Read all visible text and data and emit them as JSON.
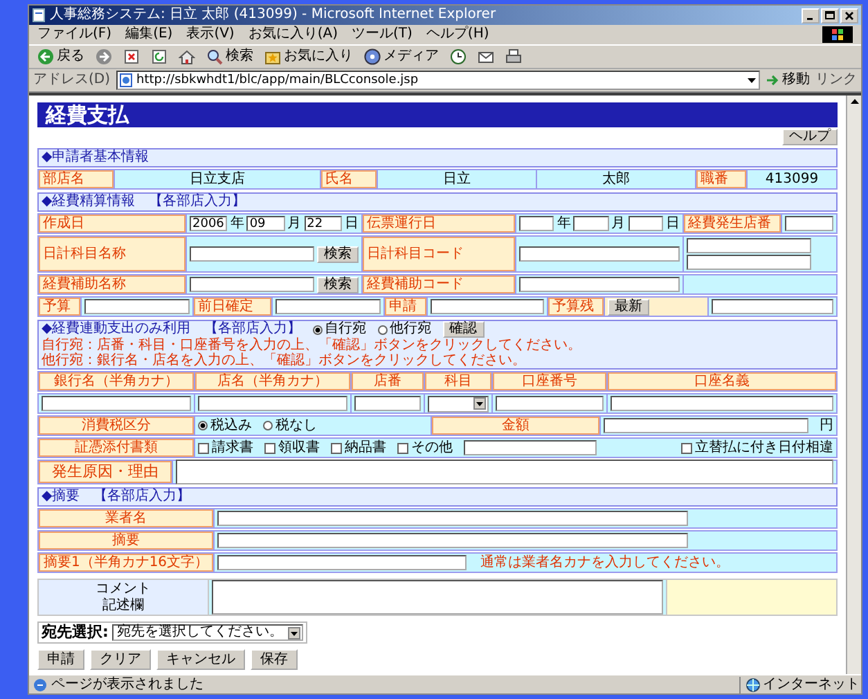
{
  "window": {
    "title": "人事総務システム: 日立 太郎 (413099) - Microsoft Internet Explorer"
  },
  "menu": [
    "ファイル(F)",
    "編集(E)",
    "表示(V)",
    "お気に入り(A)",
    "ツール(T)",
    "ヘルプ(H)"
  ],
  "toolbar": [
    {
      "kind": "back",
      "label": "戻る"
    },
    {
      "kind": "forward"
    },
    {
      "kind": "stop"
    },
    {
      "kind": "refresh"
    },
    {
      "kind": "home"
    },
    {
      "kind": "search",
      "label": "検索"
    },
    {
      "kind": "favorites",
      "label": "お気に入り"
    },
    {
      "kind": "media",
      "label": "メディア"
    },
    {
      "kind": "history"
    },
    {
      "kind": "mail"
    },
    {
      "kind": "print"
    }
  ],
  "address": {
    "label": "アドレス(D)",
    "url": "http://sbkwhdt1/blc/app/main/BLCconsole.jsp",
    "go": "移動",
    "links": "リンク"
  },
  "page": {
    "heading": "経費支払",
    "help": "ヘルプ",
    "blocks": [
      {
        "kind": "section",
        "title": "◆申請者基本情報"
      },
      {
        "kind": "row",
        "cells": [
          {
            "kind": "label",
            "text": "部店名"
          },
          {
            "kind": "value",
            "text": "日立支店"
          },
          {
            "kind": "label",
            "text": "氏名"
          },
          {
            "kind": "value",
            "text": "日立"
          },
          {
            "kind": "value",
            "text": "太郎"
          },
          {
            "kind": "label",
            "text": "職番"
          },
          {
            "kind": "value",
            "text": "413099"
          }
        ]
      },
      {
        "kind": "section",
        "title": "◆経費精算情報　【各部店入力】"
      },
      {
        "kind": "row",
        "cells": [
          {
            "kind": "label",
            "text": "作成日"
          },
          {
            "kind": "field",
            "items": [
              {
                "kind": "input",
                "value": "2006"
              },
              {
                "kind": "text",
                "text": "年"
              },
              {
                "kind": "input",
                "value": "09"
              },
              {
                "kind": "text",
                "text": "月"
              },
              {
                "kind": "input",
                "value": "22"
              },
              {
                "kind": "text",
                "text": "日"
              }
            ]
          },
          {
            "kind": "label",
            "text": "伝票運行日"
          },
          {
            "kind": "field",
            "items": [
              {
                "kind": "input"
              },
              {
                "kind": "text",
                "text": "年"
              },
              {
                "kind": "input"
              },
              {
                "kind": "text",
                "text": "月"
              },
              {
                "kind": "input"
              },
              {
                "kind": "text",
                "text": "日"
              }
            ]
          },
          {
            "kind": "label",
            "text": "経費発生店番"
          },
          {
            "kind": "field",
            "items": [
              {
                "kind": "input"
              }
            ]
          }
        ]
      },
      {
        "kind": "row",
        "cells": [
          {
            "kind": "label",
            "text": "日計科目名称"
          },
          {
            "kind": "field",
            "items": [
              {
                "kind": "input"
              },
              {
                "kind": "button",
                "label": "検索"
              }
            ]
          },
          {
            "kind": "label",
            "text": "日計科目コード"
          },
          {
            "kind": "field",
            "items": [
              {
                "kind": "input"
              }
            ]
          },
          {
            "kind": "stack",
            "items": [
              {
                "kind": "input"
              },
              {
                "kind": "input"
              }
            ]
          }
        ]
      },
      {
        "kind": "row",
        "cells": [
          {
            "kind": "label",
            "text": "経費補助名称"
          },
          {
            "kind": "field",
            "items": [
              {
                "kind": "input"
              },
              {
                "kind": "button",
                "label": "検索"
              }
            ]
          },
          {
            "kind": "label",
            "text": "経費補助コード"
          },
          {
            "kind": "field",
            "items": [
              {
                "kind": "input"
              }
            ]
          },
          {
            "kind": "blank"
          }
        ]
      },
      {
        "kind": "row",
        "cells": [
          {
            "kind": "label",
            "text": "予算"
          },
          {
            "kind": "field",
            "items": [
              {
                "kind": "input"
              }
            ]
          },
          {
            "kind": "label",
            "text": "前日確定"
          },
          {
            "kind": "field",
            "items": [
              {
                "kind": "input"
              }
            ]
          },
          {
            "kind": "label",
            "text": "申請"
          },
          {
            "kind": "field",
            "items": [
              {
                "kind": "input"
              }
            ]
          },
          {
            "kind": "label",
            "text": "予算残"
          },
          {
            "kind": "field",
            "items": [
              {
                "kind": "button",
                "label": "最新"
              }
            ]
          },
          {
            "kind": "field",
            "items": [
              {
                "kind": "input"
              }
            ]
          }
        ]
      },
      {
        "kind": "section",
        "title": "◆経費連動支出のみ利用　【各部店入力】",
        "controls": [
          {
            "kind": "radio",
            "label": "自行宛",
            "selected": true
          },
          {
            "kind": "radio",
            "label": "他行宛",
            "selected": false
          },
          {
            "kind": "button",
            "label": "確認"
          }
        ],
        "notes": [
          "自行宛：店番・科目・口座番号を入力の上、「確認」ボタンをクリックしてください。",
          "他行宛：銀行名・店名を入力の上、「確認」ボタンをクリックしてください。"
        ]
      },
      {
        "kind": "row",
        "cells": [
          {
            "kind": "header",
            "text": "銀行名（半角カナ）"
          },
          {
            "kind": "header",
            "text": "店名（半角カナ）"
          },
          {
            "kind": "header",
            "text": "店番"
          },
          {
            "kind": "header",
            "text": "科目"
          },
          {
            "kind": "header",
            "text": "口座番号"
          },
          {
            "kind": "header",
            "text": "口座名義"
          }
        ]
      },
      {
        "kind": "row",
        "cells": [
          {
            "kind": "field",
            "items": [
              {
                "kind": "input"
              }
            ]
          },
          {
            "kind": "field",
            "items": [
              {
                "kind": "input"
              }
            ]
          },
          {
            "kind": "field",
            "items": [
              {
                "kind": "input"
              }
            ]
          },
          {
            "kind": "field",
            "items": [
              {
                "kind": "select"
              }
            ]
          },
          {
            "kind": "field",
            "items": [
              {
                "kind": "input"
              }
            ]
          },
          {
            "kind": "field",
            "items": [
              {
                "kind": "input"
              }
            ]
          }
        ]
      },
      {
        "kind": "row",
        "cells": [
          {
            "kind": "label",
            "text": "消費税区分"
          },
          {
            "kind": "field",
            "items": [
              {
                "kind": "radio",
                "label": "税込み",
                "selected": true
              },
              {
                "kind": "radio",
                "label": "税なし",
                "selected": false
              }
            ]
          },
          {
            "kind": "label",
            "text": "金額"
          },
          {
            "kind": "field",
            "items": [
              {
                "kind": "input"
              },
              {
                "kind": "text",
                "text": "円"
              }
            ]
          }
        ]
      },
      {
        "kind": "row",
        "cells": [
          {
            "kind": "label",
            "text": "証憑添付書類"
          },
          {
            "kind": "field",
            "items": [
              {
                "kind": "checkbox",
                "label": "請求書",
                "checked": false
              },
              {
                "kind": "checkbox",
                "label": "領収書",
                "checked": false
              },
              {
                "kind": "checkbox",
                "label": "納品書",
                "checked": false
              },
              {
                "kind": "checkbox",
                "label": "その他",
                "checked": false
              },
              {
                "kind": "input"
              },
              {
                "kind": "checkbox",
                "label": "立替払に付き日付相違",
                "checked": false
              }
            ]
          }
        ]
      },
      {
        "kind": "row",
        "cells": [
          {
            "kind": "label",
            "text": "発生原因・理由"
          },
          {
            "kind": "field",
            "items": [
              {
                "kind": "textarea"
              }
            ]
          }
        ]
      },
      {
        "kind": "section",
        "title": "◆摘要　【各部店入力】"
      },
      {
        "kind": "row",
        "cells": [
          {
            "kind": "label",
            "text": "業者名"
          },
          {
            "kind": "field",
            "items": [
              {
                "kind": "input"
              }
            ]
          }
        ]
      },
      {
        "kind": "row",
        "cells": [
          {
            "kind": "label",
            "text": "摘要"
          },
          {
            "kind": "field",
            "items": [
              {
                "kind": "input"
              }
            ]
          }
        ]
      },
      {
        "kind": "row",
        "cells": [
          {
            "kind": "label",
            "text": "摘要1（半角カナ16文字）"
          },
          {
            "kind": "field",
            "items": [
              {
                "kind": "input"
              },
              {
                "kind": "note",
                "text": "通常は業者名カナを入力してください。"
              }
            ]
          }
        ]
      },
      {
        "kind": "row",
        "cells": [
          {
            "kind": "caption",
            "lines": [
              "コメント",
              "記述欄"
            ]
          },
          {
            "kind": "field",
            "items": [
              {
                "kind": "textarea"
              }
            ]
          },
          {
            "kind": "blank"
          }
        ]
      }
    ],
    "recipient": {
      "label": "宛先選択:",
      "value": "宛先を選択してください。"
    },
    "buttons": [
      "申請",
      "クリア",
      "キャンセル",
      "保存"
    ]
  },
  "status_bar": {
    "text": "ページが表示されました",
    "zone": "インターネット"
  }
}
